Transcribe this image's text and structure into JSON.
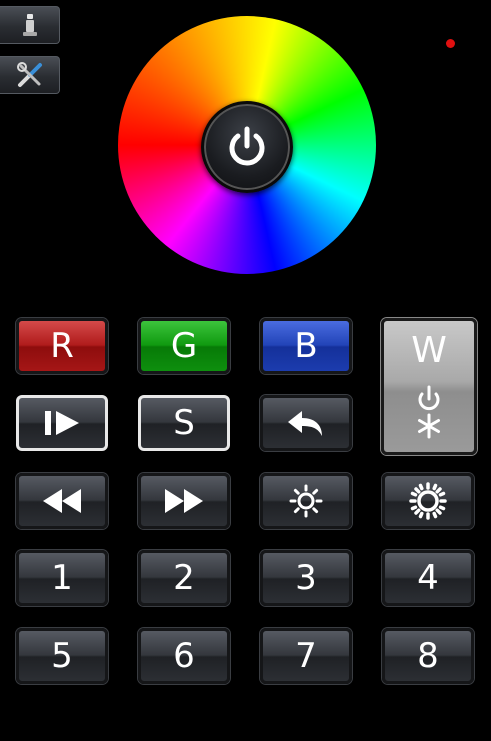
{
  "sidebar": {
    "user_button_icon": "person-icon",
    "settings_button_icon": "tools-icon"
  },
  "indicator": {
    "color": "#e01010"
  },
  "color_wheel": {
    "center_icon": "power-icon"
  },
  "keypad": {
    "r_label": "R",
    "g_label": "G",
    "b_label": "B",
    "w_label": "W",
    "s_label": "S",
    "numbers": [
      "1",
      "2",
      "3",
      "4",
      "5",
      "6",
      "7",
      "8"
    ]
  },
  "colors": {
    "red": "#b01c1c",
    "green": "#109a10",
    "blue": "#2244b8",
    "white_key": "#a9a9a9"
  }
}
